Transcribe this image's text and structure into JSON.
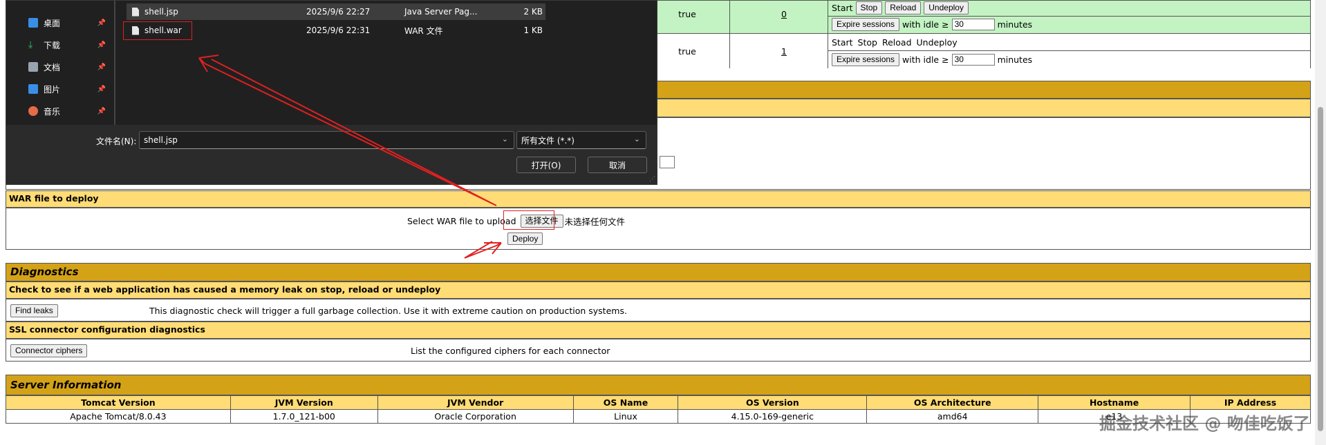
{
  "apps_table": {
    "rows": [
      {
        "running": "true",
        "sessions": "0",
        "commands": [
          "Start",
          "Stop",
          "Reload",
          "Undeploy"
        ],
        "expire_label": "Expire sessions",
        "idle_prefix": "with idle ≥",
        "idle_value": "30",
        "idle_suffix": "minutes"
      },
      {
        "running": "true",
        "sessions": "1",
        "commands": [
          "Start",
          "Stop",
          "Reload",
          "Undeploy"
        ],
        "expire_label": "Expire sessions",
        "idle_prefix": "with idle ≥",
        "idle_value": "30",
        "idle_suffix": "minutes"
      }
    ]
  },
  "deploy_war": {
    "header": "WAR file to deploy",
    "select_label": "Select WAR file to upload",
    "choose_button": "选择文件",
    "no_file_text": "未选择任何文件",
    "deploy_button": "Deploy"
  },
  "diagnostics": {
    "title": "Diagnostics",
    "leak_header": "Check to see if a web application has caused a memory leak on stop, reload or undeploy",
    "find_leaks_button": "Find leaks",
    "leak_text": "This diagnostic check will trigger a full garbage collection. Use it with extreme caution on production systems.",
    "ssl_header": "SSL connector configuration diagnostics",
    "ciphers_button": "Connector ciphers",
    "ciphers_text": "List the configured ciphers for each connector"
  },
  "server_info": {
    "title": "Server Information",
    "headers": [
      "Tomcat Version",
      "JVM Version",
      "JVM Vendor",
      "OS Name",
      "OS Version",
      "OS Architecture",
      "Hostname",
      "IP Address"
    ],
    "values": [
      "Apache Tomcat/8.0.43",
      "1.7.0_121-b00",
      "Oracle Corporation",
      "Linux",
      "4.15.0-169-generic",
      "amd64",
      "e13",
      ""
    ]
  },
  "file_dialog": {
    "sidebar": [
      {
        "label": "桌面",
        "icon": "desktop-icon",
        "color": "#3a8ee6"
      },
      {
        "label": "下载",
        "icon": "download-icon",
        "color": "#34c07a"
      },
      {
        "label": "文档",
        "icon": "document-icon",
        "color": "#9aa4b0"
      },
      {
        "label": "图片",
        "icon": "picture-icon",
        "color": "#3a8ee6"
      },
      {
        "label": "音乐",
        "icon": "music-icon",
        "color": "#e66b4a"
      }
    ],
    "files": [
      {
        "name": "shell.jsp",
        "date": "2025/9/6 22:27",
        "type": "Java Server Pag...",
        "size": "2 KB"
      },
      {
        "name": "shell.war",
        "date": "2025/9/6 22:31",
        "type": "WAR 文件",
        "size": "1 KB"
      }
    ],
    "filename_label": "文件名(N):",
    "filename_value": "shell.jsp",
    "filter_value": "所有文件 (*.*)",
    "open_button": "打开(O)",
    "cancel_button": "取消"
  },
  "watermark": "掘金技术社区 @ 吻佳吃饭了"
}
